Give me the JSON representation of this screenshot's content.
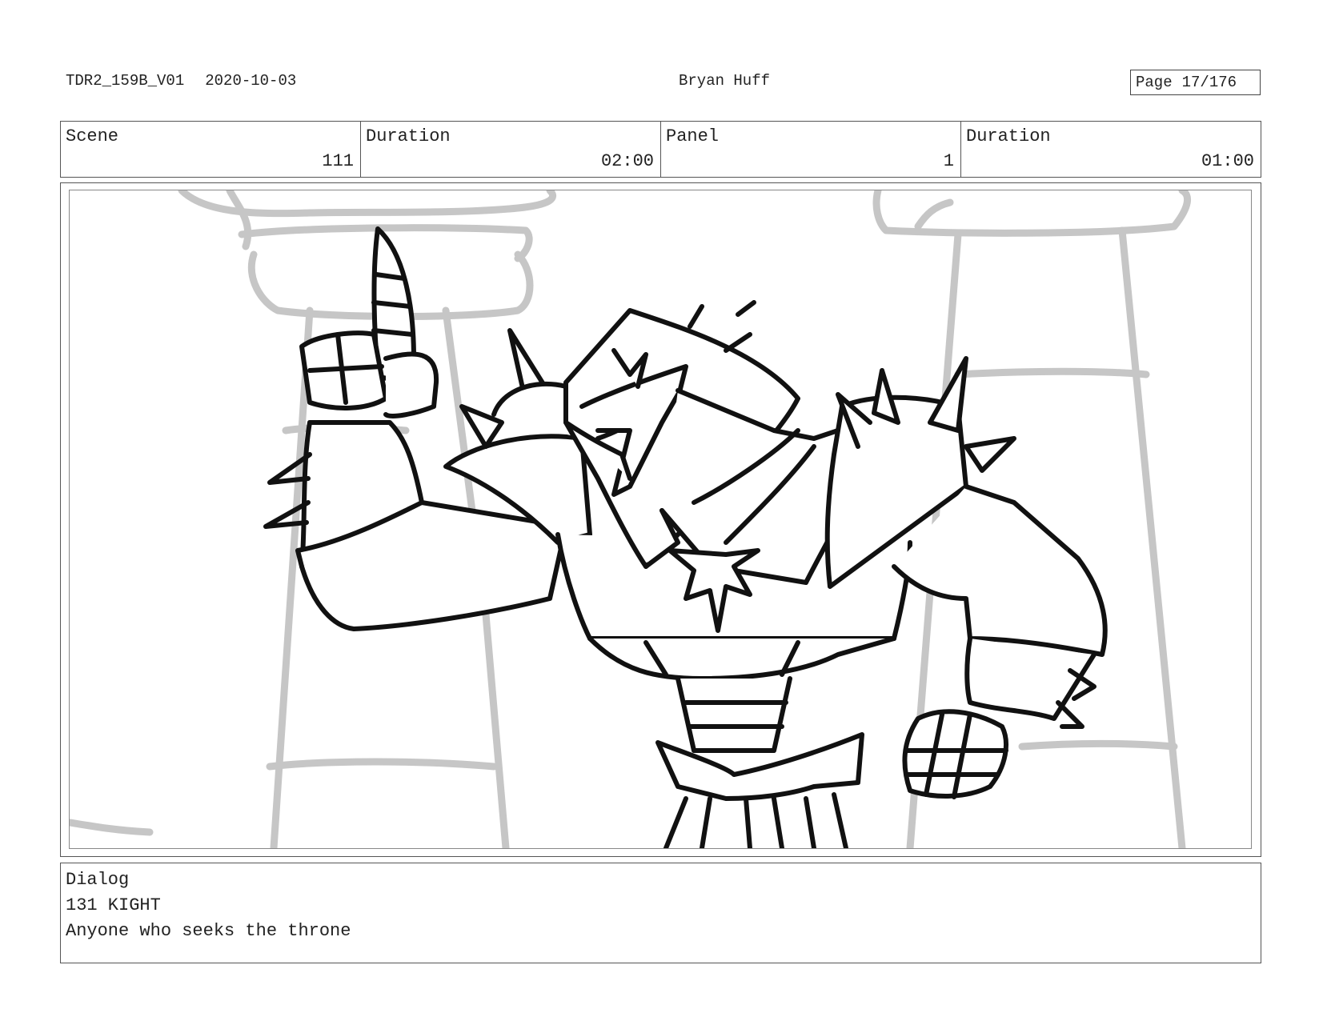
{
  "header": {
    "file_name": "TDR2_159B_V01",
    "date": "2020-10-03",
    "artist": "Bryan Huff",
    "page_label": "Page",
    "page_number": "17/176"
  },
  "info": {
    "scene_label": "Scene",
    "scene_value": "111",
    "scene_duration_label": "Duration",
    "scene_duration_value": "02:00",
    "panel_label": "Panel",
    "panel_value": "1",
    "panel_duration_label": "Duration",
    "panel_duration_value": "01:00"
  },
  "dialog": {
    "title": "Dialog",
    "character": "131 KIGHT",
    "line": "Anyone who seeks the throne"
  },
  "colors": {
    "sketch_gray": "#c6c6c6",
    "ink": "#111111"
  }
}
